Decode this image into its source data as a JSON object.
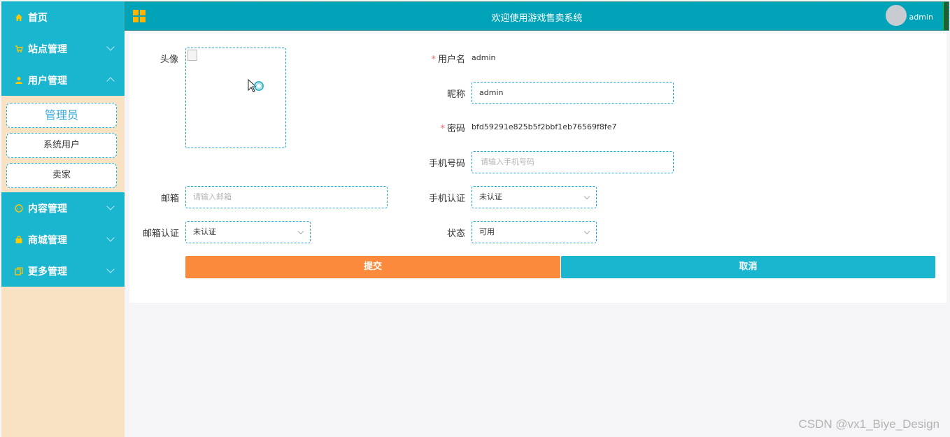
{
  "sidebar": {
    "items": [
      {
        "label": "首页",
        "icon": "home-icon"
      },
      {
        "label": "站点管理",
        "icon": "cart-icon"
      },
      {
        "label": "用户管理",
        "icon": "user-icon"
      },
      {
        "label": "内容管理",
        "icon": "chat-icon"
      },
      {
        "label": "商城管理",
        "icon": "bag-icon"
      },
      {
        "label": "更多管理",
        "icon": "copy-icon"
      }
    ],
    "submenu": [
      "管理员",
      "系统用户",
      "卖家"
    ]
  },
  "header": {
    "title": "欢迎使用游戏售卖系统",
    "user": "admin"
  },
  "form": {
    "avatar_label": "头像",
    "username_label": "用户名",
    "username_value": "admin",
    "nickname_label": "昵称",
    "nickname_value": "admin",
    "password_label": "密码",
    "password_value": "bfd59291e825b5f2bbf1eb76569f8fe7",
    "phone_label": "手机号码",
    "phone_placeholder": "请输入手机号码",
    "email_label": "邮箱",
    "email_placeholder": "请输入邮箱",
    "phone_verify_label": "手机认证",
    "phone_verify_value": "未认证",
    "email_verify_label": "邮箱认证",
    "email_verify_value": "未认证",
    "status_label": "状态",
    "status_value": "可用",
    "submit_label": "提交",
    "cancel_label": "取消"
  },
  "watermark": "CSDN @vx1_Biye_Design",
  "colors": {
    "accent": "#1ab5cf",
    "header": "#00a3b8",
    "submit": "#fb8a3c",
    "sidebar_bg": "#f9e2c3"
  }
}
